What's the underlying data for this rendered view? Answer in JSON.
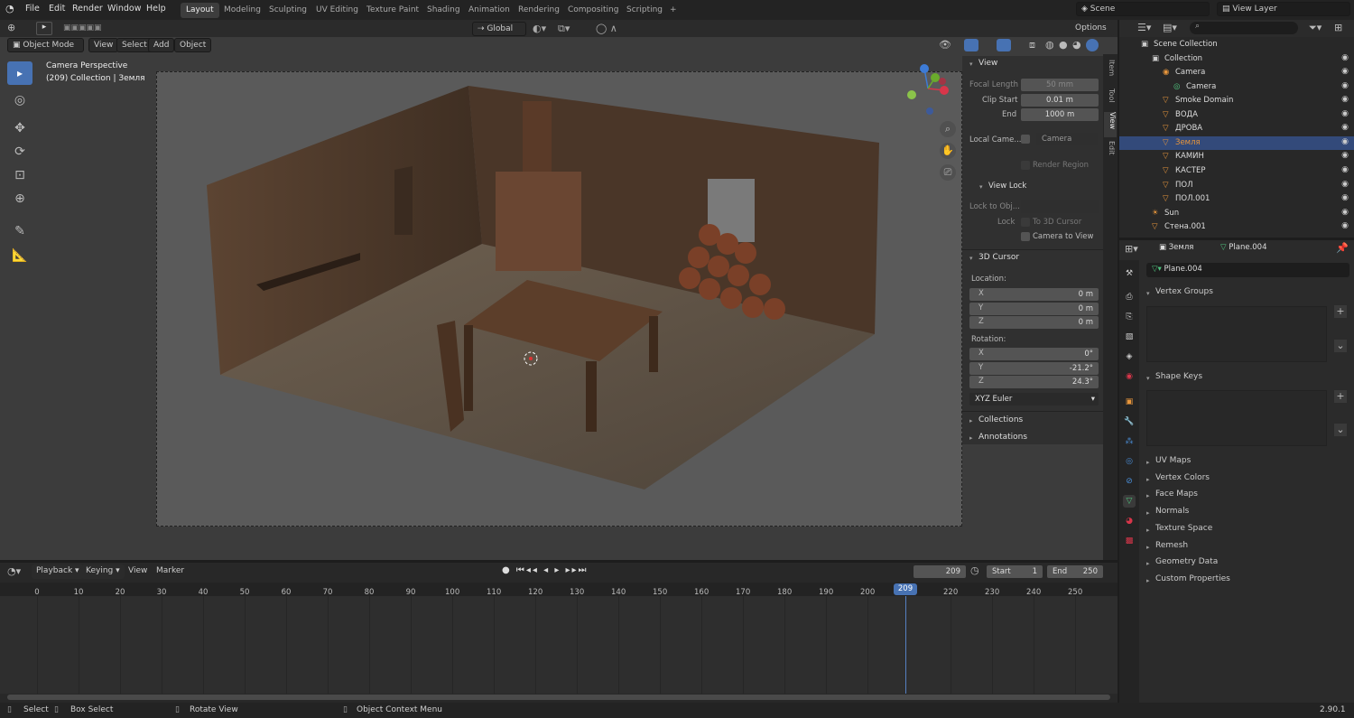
{
  "menu": {
    "items": [
      "File",
      "Edit",
      "Render",
      "Window",
      "Help"
    ]
  },
  "workspaces": [
    "Layout",
    "Modeling",
    "Sculpting",
    "UV Editing",
    "Texture Paint",
    "Shading",
    "Animation",
    "Rendering",
    "Compositing",
    "Scripting",
    "+"
  ],
  "scene": {
    "name": "Scene",
    "view_layer": "View Layer"
  },
  "header": {
    "mode": "Object Mode",
    "menus": [
      "View",
      "Select",
      "Add",
      "Object"
    ],
    "orientation": "Global",
    "options": "Options"
  },
  "overlay_text": {
    "line1": "Camera Perspective",
    "line2": "(209) Collection | Земля"
  },
  "npanel": {
    "view_title": "View",
    "focal_label": "Focal Length",
    "focal": "50 mm",
    "clip_start_label": "Clip Start",
    "clip_start": "0.01 m",
    "end_label": "End",
    "end": "1000 m",
    "local_camera_label": "Local Came...",
    "local_camera": "Camera",
    "render_region": "Render Region",
    "view_lock_title": "View Lock",
    "lock_obj_label": "Lock to Obj...",
    "lock_label": "Lock",
    "to_cursor": "To 3D Cursor",
    "camera_to_view": "Camera to View",
    "cursor_title": "3D Cursor",
    "location_label": "Location:",
    "rotation_label": "Rotation:",
    "loc": [
      {
        "axis": "X",
        "val": "0 m"
      },
      {
        "axis": "Y",
        "val": "0 m"
      },
      {
        "axis": "Z",
        "val": "0 m"
      }
    ],
    "rot": [
      {
        "axis": "X",
        "val": "0°"
      },
      {
        "axis": "Y",
        "val": "-21.2°"
      },
      {
        "axis": "Z",
        "val": "24.3°"
      }
    ],
    "rot_mode": "XYZ Euler",
    "collections": "Collections",
    "annotations": "Annotations"
  },
  "vtabs": [
    "Item",
    "Tool",
    "View",
    "Edit"
  ],
  "outliner": {
    "rows": [
      {
        "name": "Scene Collection",
        "indent": 0,
        "icon": "▣",
        "color": "#ccc"
      },
      {
        "name": "Collection",
        "indent": 1,
        "icon": "▣",
        "color": "#ccc"
      },
      {
        "name": "Camera",
        "indent": 2,
        "icon": "◉",
        "color": "#e8963c"
      },
      {
        "name": "Camera",
        "indent": 3,
        "icon": "◎",
        "color": "#4fc37e"
      },
      {
        "name": "Smoke Domain",
        "indent": 2,
        "icon": "▽",
        "color": "#e8963c"
      },
      {
        "name": "ВОДА",
        "indent": 2,
        "icon": "▽",
        "color": "#e8963c"
      },
      {
        "name": "ДРОВА",
        "indent": 2,
        "icon": "▽",
        "color": "#e8963c"
      },
      {
        "name": "Земля",
        "indent": 2,
        "icon": "▽",
        "color": "#e8963c",
        "selected": true
      },
      {
        "name": "КАМИН",
        "indent": 2,
        "icon": "▽",
        "color": "#e8963c"
      },
      {
        "name": "КАСТЕР",
        "indent": 2,
        "icon": "▽",
        "color": "#e8963c"
      },
      {
        "name": "ПОЛ",
        "indent": 2,
        "icon": "▽",
        "color": "#e8963c"
      },
      {
        "name": "ПОЛ.001",
        "indent": 2,
        "icon": "▽",
        "color": "#e8963c"
      },
      {
        "name": "Sun",
        "indent": 1,
        "icon": "☀",
        "color": "#e8963c"
      },
      {
        "name": "Стена.001",
        "indent": 1,
        "icon": "▽",
        "color": "#e8963c"
      }
    ]
  },
  "props": {
    "object": "Земля",
    "mesh": "Plane.004",
    "mesh_field": "Plane.004",
    "vertex_groups": "Vertex Groups",
    "shape_keys": "Shape Keys",
    "sections": [
      "UV Maps",
      "Vertex Colors",
      "Face Maps",
      "Normals",
      "Texture Space",
      "Remesh",
      "Geometry Data",
      "Custom Properties"
    ]
  },
  "timeline": {
    "menus": [
      "Playback",
      "Keying",
      "View",
      "Marker"
    ],
    "current": "209",
    "start_label": "Start",
    "start": "1",
    "end_label": "End",
    "end": "250",
    "frames": [
      "0",
      "10",
      "20",
      "30",
      "40",
      "50",
      "60",
      "70",
      "80",
      "90",
      "100",
      "110",
      "120",
      "130",
      "140",
      "150",
      "160",
      "170",
      "180",
      "190",
      "200",
      "209",
      "220",
      "230",
      "240",
      "250"
    ]
  },
  "status": {
    "select": "Select",
    "box": "Box Select",
    "rotate": "Rotate View",
    "context": "Object Context Menu",
    "version": "2.90.1"
  }
}
